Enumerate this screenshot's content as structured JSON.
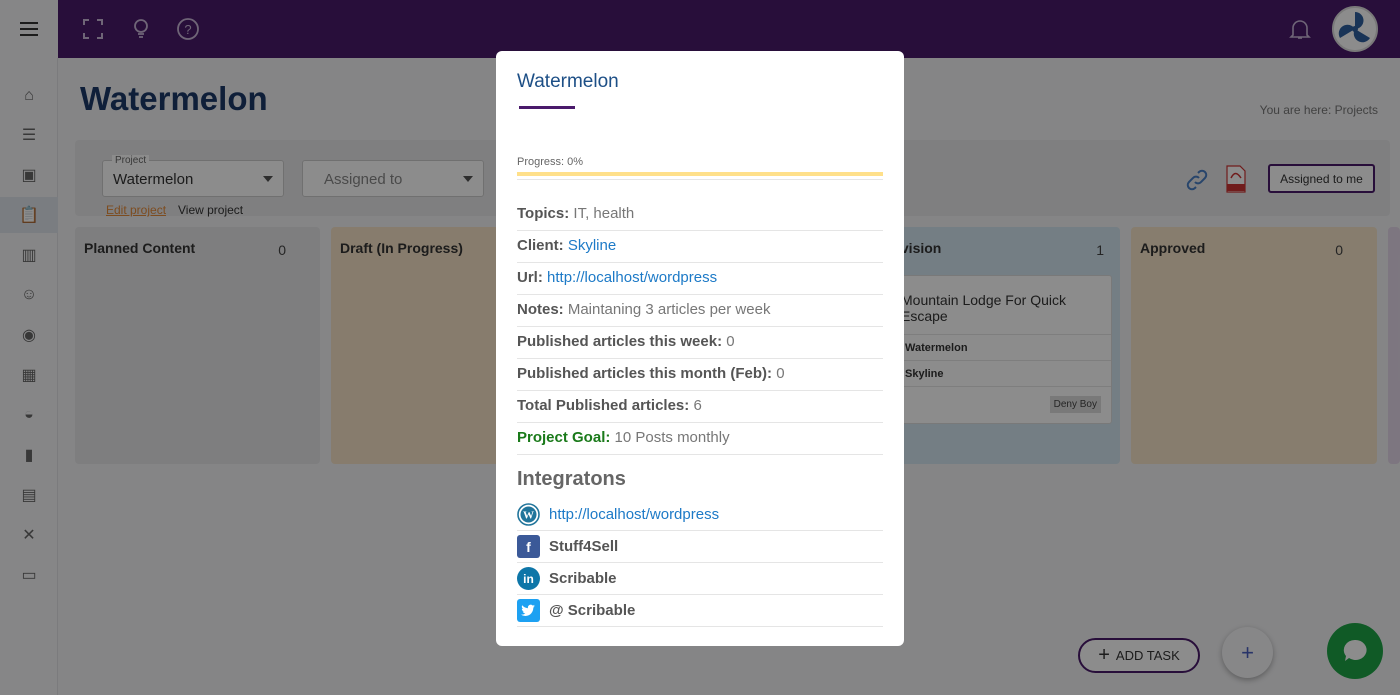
{
  "page": {
    "title": "Watermelon",
    "breadcrumb_prefix": "You are here:",
    "breadcrumb_current": "Projects"
  },
  "filters": {
    "project_label": "Project",
    "project_value": "Watermelon",
    "assigned_placeholder": "Assigned to",
    "edit_link": "Edit project",
    "view_link": "View project",
    "assigned_to_me": "Assigned to me"
  },
  "columns": [
    {
      "title": "Planned Content",
      "count": "0",
      "color": "#e6e6e8"
    },
    {
      "title": "Draft (In Progress)",
      "count": "",
      "color": "#f6e2c6"
    },
    {
      "title": "Revision",
      "count": "1",
      "color": "#d3e5f1"
    },
    {
      "title": "Approved",
      "count": "0",
      "color": "#f6e4c9"
    }
  ],
  "card": {
    "title": "Mountain Lodge For Quick Escape",
    "project": "Watermelon",
    "client": "Skyline",
    "badge": "Deny Boy"
  },
  "actions": {
    "add_task": "ADD TASK",
    "fab": "+"
  },
  "modal": {
    "title": "Watermelon",
    "progress_label": "Progress: 0%",
    "progress_fraction": 0,
    "rows": [
      {
        "label": "Topics:",
        "value": "IT, health",
        "kind": "plain"
      },
      {
        "label": "Client:",
        "value": "Skyline",
        "kind": "link"
      },
      {
        "label": "Url:",
        "value": "http://localhost/wordpress",
        "kind": "link"
      },
      {
        "label": "Notes:",
        "value": "Maintaning 3 articles per week",
        "kind": "plain"
      },
      {
        "label": "Published articles this week:",
        "value": "0",
        "kind": "plain"
      },
      {
        "label": "Published articles this month (Feb):",
        "value": "0",
        "kind": "plain"
      },
      {
        "label": "Total Published articles:",
        "value": "6",
        "kind": "plain"
      },
      {
        "label": "Project Goal:",
        "value": "10 Posts monthly",
        "kind": "goal"
      }
    ],
    "integrations_title": "Integratons",
    "integrations": [
      {
        "icon": "wordpress-icon",
        "text": "http://localhost/wordpress",
        "kind": "link",
        "color": "#21759b"
      },
      {
        "icon": "facebook-icon",
        "text": "Stuff4Sell",
        "kind": "plain",
        "color": "#3b5998"
      },
      {
        "icon": "linkedin-icon",
        "text": "Scribable",
        "kind": "plain",
        "color": "#0e76a8"
      },
      {
        "icon": "twitter-icon",
        "text": "@ Scribable",
        "kind": "plain",
        "color": "#1da1f2"
      }
    ]
  },
  "colors": {
    "brand": "#4a1a6b",
    "title_blue": "#1d4f86",
    "link_blue": "#1d7ac7",
    "goal_green": "#1a7a1a",
    "chat_green": "#1ea446"
  }
}
